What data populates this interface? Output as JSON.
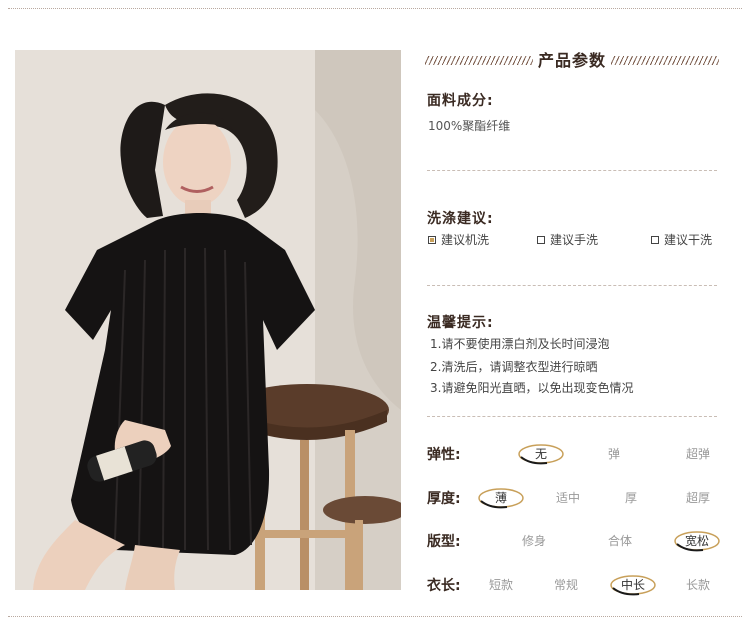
{
  "header": {
    "title": "产品参数"
  },
  "fabric": {
    "title": "面料成分:",
    "value": "100%聚酯纤维"
  },
  "washing": {
    "title": "洗涤建议:",
    "options": [
      {
        "label": "建议机洗",
        "checked": true
      },
      {
        "label": "建议手洗",
        "checked": false
      },
      {
        "label": "建议干洗",
        "checked": false
      }
    ]
  },
  "tips": {
    "title": "温馨提示:",
    "items": [
      "1.请不要使用漂白剂及长时间浸泡",
      "2.清洗后，请调整衣型进行晾晒",
      "3.请避免阳光直晒，以免出现变色情况"
    ]
  },
  "attributes": [
    {
      "label": "弹性:",
      "options": [
        "无",
        "弹",
        "超弹"
      ],
      "selected": 0
    },
    {
      "label": "厚度:",
      "options": [
        "薄",
        "适中",
        "厚",
        "超厚"
      ],
      "selected": 0
    },
    {
      "label": "版型:",
      "options": [
        "修身",
        "合体",
        "宽松"
      ],
      "selected": 2
    },
    {
      "label": "衣长:",
      "options": [
        "短款",
        "常规",
        "中长",
        "长款"
      ],
      "selected": 2
    }
  ],
  "colors": {
    "accent": "#c8a05a",
    "title": "#3a2a22"
  }
}
